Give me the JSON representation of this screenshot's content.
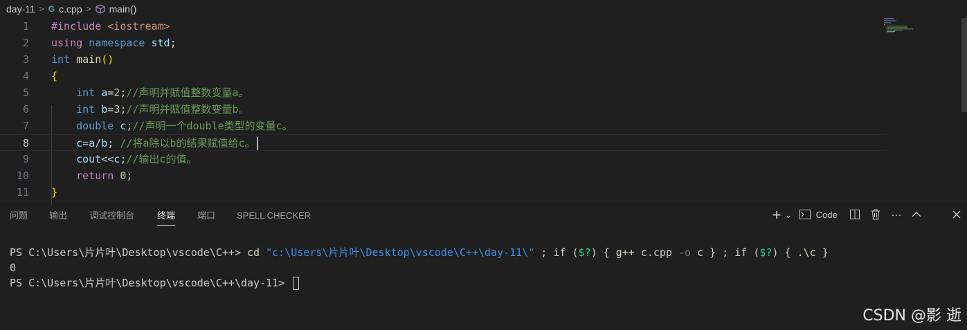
{
  "breadcrumb": {
    "folder": "day-11",
    "file_icon": "G",
    "file": "c.cpp",
    "symbol": "main()"
  },
  "editor": {
    "lines": [
      {
        "num": "1",
        "tokens": [
          {
            "t": "#include",
            "c": "ctl"
          },
          {
            "t": " ",
            "c": "plain"
          },
          {
            "t": "<iostream>",
            "c": "inc"
          }
        ]
      },
      {
        "num": "2",
        "tokens": [
          {
            "t": "using",
            "c": "ctl"
          },
          {
            "t": " ",
            "c": "plain"
          },
          {
            "t": "namespace",
            "c": "kw"
          },
          {
            "t": " ",
            "c": "plain"
          },
          {
            "t": "std",
            "c": "var"
          },
          {
            "t": ";",
            "c": "plain"
          }
        ]
      },
      {
        "num": "3",
        "tokens": [
          {
            "t": "int",
            "c": "ty"
          },
          {
            "t": " ",
            "c": "plain"
          },
          {
            "t": "main",
            "c": "fn"
          },
          {
            "t": "()",
            "c": "br1"
          }
        ]
      },
      {
        "num": "4",
        "tokens": [
          {
            "t": "{",
            "c": "br1"
          }
        ]
      },
      {
        "num": "5",
        "tokens": [
          {
            "t": "    ",
            "c": "plain"
          },
          {
            "t": "int",
            "c": "ty"
          },
          {
            "t": " ",
            "c": "plain"
          },
          {
            "t": "a",
            "c": "var"
          },
          {
            "t": "=",
            "c": "plain"
          },
          {
            "t": "2",
            "c": "num"
          },
          {
            "t": ";",
            "c": "plain"
          },
          {
            "t": "//声明并赋值整数变量a。",
            "c": "cm"
          }
        ]
      },
      {
        "num": "6",
        "tokens": [
          {
            "t": "    ",
            "c": "plain"
          },
          {
            "t": "int",
            "c": "ty"
          },
          {
            "t": " ",
            "c": "plain"
          },
          {
            "t": "b",
            "c": "var"
          },
          {
            "t": "=",
            "c": "plain"
          },
          {
            "t": "3",
            "c": "num"
          },
          {
            "t": ";",
            "c": "plain"
          },
          {
            "t": "//声明并赋值整数变量b。",
            "c": "cm"
          }
        ]
      },
      {
        "num": "7",
        "tokens": [
          {
            "t": "    ",
            "c": "plain"
          },
          {
            "t": "double",
            "c": "ty"
          },
          {
            "t": " ",
            "c": "plain"
          },
          {
            "t": "c",
            "c": "var"
          },
          {
            "t": ";",
            "c": "plain"
          },
          {
            "t": "//声明一个double类型的变量c。",
            "c": "cm"
          }
        ]
      },
      {
        "num": "8",
        "tokens": [
          {
            "t": "    ",
            "c": "plain"
          },
          {
            "t": "c",
            "c": "var"
          },
          {
            "t": "=",
            "c": "plain"
          },
          {
            "t": "a",
            "c": "var"
          },
          {
            "t": "/",
            "c": "plain"
          },
          {
            "t": "b",
            "c": "var"
          },
          {
            "t": "; ",
            "c": "plain"
          },
          {
            "t": "//将a除以b的结果赋值给c。",
            "c": "cm"
          }
        ]
      },
      {
        "num": "9",
        "tokens": [
          {
            "t": "    ",
            "c": "plain"
          },
          {
            "t": "cout",
            "c": "var"
          },
          {
            "t": "<<",
            "c": "plain"
          },
          {
            "t": "c",
            "c": "var"
          },
          {
            "t": ";",
            "c": "plain"
          },
          {
            "t": "//输出c的值。",
            "c": "cm"
          }
        ]
      },
      {
        "num": "10",
        "tokens": [
          {
            "t": "    ",
            "c": "plain"
          },
          {
            "t": "return",
            "c": "ctl"
          },
          {
            "t": " ",
            "c": "plain"
          },
          {
            "t": "0",
            "c": "num"
          },
          {
            "t": ";",
            "c": "plain"
          }
        ]
      },
      {
        "num": "11",
        "tokens": [
          {
            "t": "}",
            "c": "br1"
          }
        ]
      }
    ],
    "current_line": "8"
  },
  "panel": {
    "tabs": [
      "问题",
      "输出",
      "调试控制台",
      "终端",
      "端口",
      "SPELL CHECKER"
    ],
    "active_tab": "终端",
    "actions": {
      "add": "+",
      "dropdown": "⌄",
      "launch_profile": "Code",
      "split": "◫",
      "trash": "🗑",
      "more": "···",
      "maximize": "^",
      "close": "✕"
    }
  },
  "terminal": {
    "line1": {
      "prompt": "PS C:\\Users\\片片叶\\Desktop\\vscode\\C++> ",
      "cmd": "cd",
      "path": "\"c:\\Users\\片片叶\\Desktop\\vscode\\C++\\day-11\\\"",
      "sep1": " ; ",
      "if1": "if",
      "cond1a": " (",
      "var1": "$?",
      "cond1b": ") { ",
      "gpp": "g++",
      "src": " c.cpp ",
      "flag": "-o",
      "out": " c } ; ",
      "if2": "if",
      "cond2a": " (",
      "var2": "$?",
      "cond2b": ") { ",
      "run": ".\\c",
      "end": " }"
    },
    "line2": "0",
    "line3": "PS C:\\Users\\片片叶\\Desktop\\vscode\\C++\\day-11> "
  },
  "watermark": "CSDN @影 逝"
}
